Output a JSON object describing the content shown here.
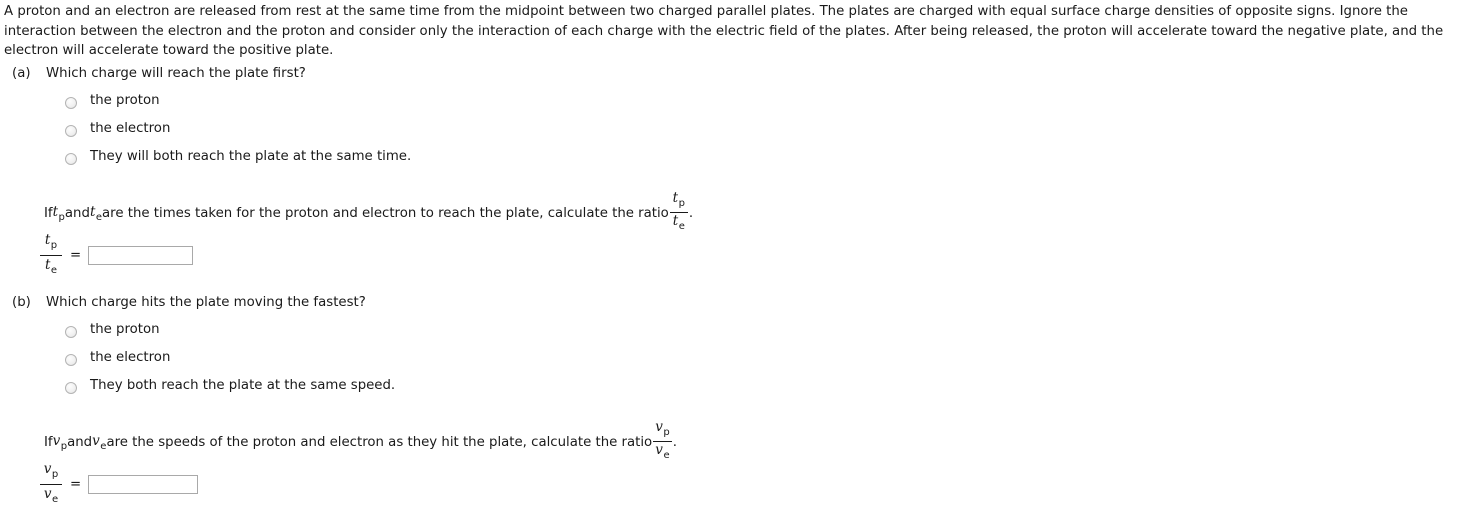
{
  "problem": {
    "intro": "A proton and an electron are released from rest at the same time from the midpoint between two charged parallel plates. The plates are charged with equal surface charge densities of opposite signs. Ignore the interaction between the electron and the proton and consider only the interaction of each charge with the electric field of the plates. After being released, the proton will accelerate toward the negative plate, and the electron will accelerate toward the positive plate."
  },
  "parts": [
    {
      "label": "(a)",
      "question": "Which charge will reach the plate first?",
      "options": [
        "the proton",
        "the electron",
        "They will both reach the plate at the same time."
      ],
      "ratio_sentence": {
        "lead": "If ",
        "var1_base": "t",
        "var1_sub": "p",
        "middle": " and ",
        "var2_base": "t",
        "var2_sub": "e",
        "tail": " are the times taken for the proton and electron to reach the plate, calculate the ratio ",
        "fraction_num_base": "t",
        "fraction_num_sub": "p",
        "fraction_den_base": "t",
        "fraction_den_sub": "e",
        "period": "."
      },
      "answer": {
        "num_base": "t",
        "num_sub": "p",
        "den_base": "t",
        "den_sub": "e",
        "equals": "=",
        "value": "",
        "placeholder": ""
      }
    },
    {
      "label": "(b)",
      "question": "Which charge hits the plate moving the fastest?",
      "options": [
        "the proton",
        "the electron",
        "They both reach the plate at the same speed."
      ],
      "ratio_sentence": {
        "lead": "If ",
        "var1_base": "v",
        "var1_sub": "p",
        "middle": " and ",
        "var2_base": "v",
        "var2_sub": "e",
        "tail": " are the speeds of the proton and electron as they hit the plate, calculate the ratio ",
        "fraction_num_base": "v",
        "fraction_num_sub": "p",
        "fraction_den_base": "v",
        "fraction_den_sub": "e",
        "period": "."
      },
      "answer": {
        "num_base": "v",
        "num_sub": "p",
        "den_base": "v",
        "den_sub": "e",
        "equals": "=",
        "value": "",
        "placeholder": ""
      }
    }
  ],
  "colors": {
    "text": "#1a1a1a",
    "input_border": "#a9a9a9",
    "radio_border": "#b4b4b4",
    "background": "#ffffff"
  }
}
